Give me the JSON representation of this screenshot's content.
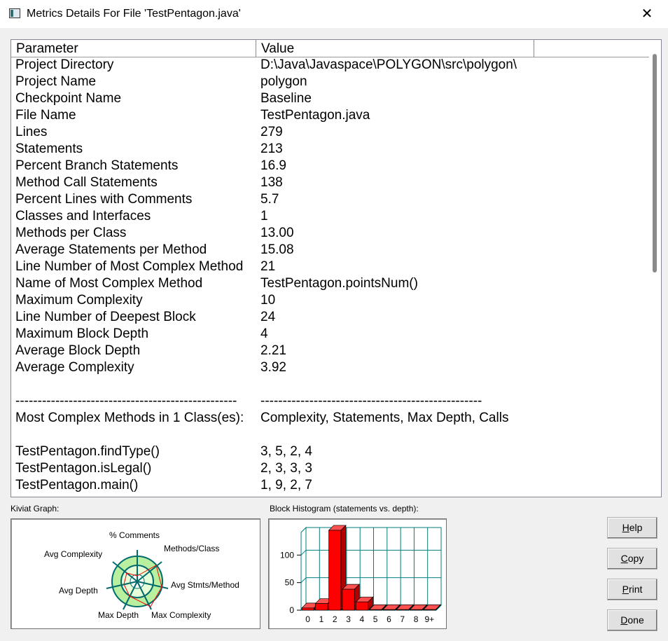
{
  "window": {
    "title": "Metrics Details For File 'TestPentagon.java'",
    "close_glyph": "✕"
  },
  "table": {
    "headers": {
      "parameter": "Parameter",
      "value": "Value"
    },
    "rows": [
      {
        "param": "Project Directory",
        "value": "D:\\Java\\Javaspace\\POLYGON\\src\\polygon\\"
      },
      {
        "param": "Project Name",
        "value": "polygon"
      },
      {
        "param": "Checkpoint Name",
        "value": "Baseline"
      },
      {
        "param": "File Name",
        "value": "TestPentagon.java"
      },
      {
        "param": "Lines",
        "value": "279"
      },
      {
        "param": "Statements",
        "value": "213"
      },
      {
        "param": "Percent Branch Statements",
        "value": "16.9"
      },
      {
        "param": "Method Call Statements",
        "value": "138"
      },
      {
        "param": "Percent Lines with Comments",
        "value": "5.7"
      },
      {
        "param": "Classes and Interfaces",
        "value": "1"
      },
      {
        "param": "Methods per Class",
        "value": "13.00"
      },
      {
        "param": "Average Statements per Method",
        "value": "15.08"
      },
      {
        "param": "Line Number of Most Complex Method",
        "value": "21"
      },
      {
        "param": "Name of Most Complex Method",
        "value": "TestPentagon.pointsNum()"
      },
      {
        "param": "Maximum Complexity",
        "value": "10"
      },
      {
        "param": "Line Number of Deepest Block",
        "value": "24"
      },
      {
        "param": "Maximum Block Depth",
        "value": "4"
      },
      {
        "param": "Average Block Depth",
        "value": "2.21"
      },
      {
        "param": "Average Complexity",
        "value": "3.92"
      },
      {
        "param": "",
        "value": ""
      },
      {
        "param": "--------------------------------------------------",
        "value": "--------------------------------------------------"
      },
      {
        "param": "Most Complex Methods in 1 Class(es):",
        "value": "Complexity, Statements, Max Depth, Calls"
      },
      {
        "param": "",
        "value": ""
      },
      {
        "param": "TestPentagon.findType()",
        "value": "3, 5, 2, 4"
      },
      {
        "param": "TestPentagon.isLegal()",
        "value": "2, 3, 3, 3"
      },
      {
        "param": "TestPentagon.main()",
        "value": "1, 9, 2, 7"
      }
    ]
  },
  "kiviat": {
    "label": "Kiviat Graph:",
    "axes": [
      "% Comments",
      "Methods/Class",
      "Avg Stmts/Method",
      "Max Complexity",
      "Max Depth",
      "Avg Depth",
      "Avg Complexity"
    ],
    "colors": {
      "outer_ring": "#b9f0a0",
      "inner_ring": "#e6ffd8",
      "polygon": "#ff0000",
      "axis": "#006b6b"
    }
  },
  "histogram": {
    "label": "Block Histogram (statements vs. depth):",
    "bar_color": "#ff0000",
    "grid_color": "#007b7b",
    "chart_data": {
      "type": "bar",
      "categories": [
        "0",
        "1",
        "2",
        "3",
        "4",
        "5",
        "6",
        "7",
        "8",
        "9+"
      ],
      "values": [
        4,
        12,
        145,
        38,
        15,
        1,
        1,
        1,
        1,
        1
      ],
      "yticks": [
        "0",
        "50",
        "100"
      ],
      "ylim": [
        0,
        150
      ]
    }
  },
  "buttons": {
    "help": {
      "pre": "",
      "key": "H",
      "post": "elp"
    },
    "copy": {
      "pre": "",
      "key": "C",
      "post": "opy"
    },
    "print": {
      "pre": "",
      "key": "P",
      "post": "rint"
    },
    "done": {
      "pre": "",
      "key": "D",
      "post": "one"
    }
  }
}
